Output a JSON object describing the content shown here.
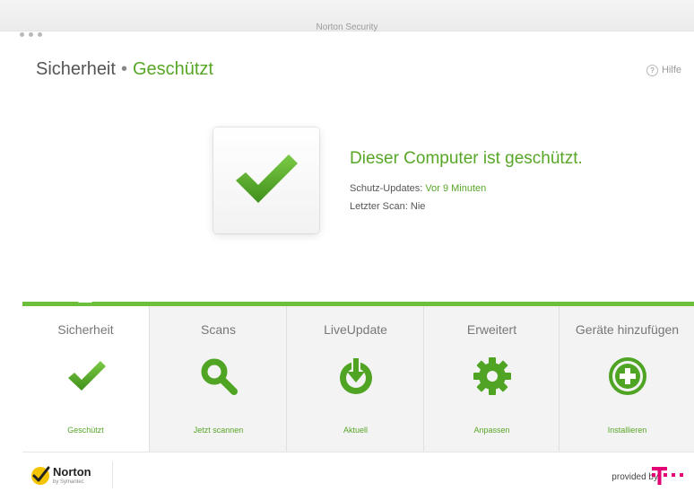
{
  "window": {
    "title": "Norton Security"
  },
  "header": {
    "section": "Sicherheit",
    "separator": "•",
    "status": "Geschützt",
    "help_label": "Hilfe",
    "help_symbol": "?"
  },
  "status_panel": {
    "headline": "Dieser Computer ist geschützt.",
    "updates_label": "Schutz-Updates:",
    "updates_value": "Vor 9 Minuten",
    "scan_label": "Letzter Scan:",
    "scan_value": "Nie"
  },
  "tabs": [
    {
      "label": "Sicherheit",
      "icon": "checkmark-icon",
      "status": "Geschützt",
      "active": true
    },
    {
      "label": "Scans",
      "icon": "magnifier-icon",
      "status": "Jetzt scannen",
      "active": false
    },
    {
      "label": "LiveUpdate",
      "icon": "download-icon",
      "status": "Aktuell",
      "active": false
    },
    {
      "label": "Erweitert",
      "icon": "gear-icon",
      "status": "Anpassen",
      "active": false
    },
    {
      "label": "Geräte hinzufügen",
      "icon": "plus-circle-icon",
      "status": "Installieren",
      "active": false
    }
  ],
  "footer": {
    "brand": "Norton",
    "brand_sub": "by Symantec",
    "provided_by": "provided by"
  },
  "colors": {
    "accent": "#58a627",
    "bar": "#6cbf3a",
    "telekom": "#e20074"
  }
}
